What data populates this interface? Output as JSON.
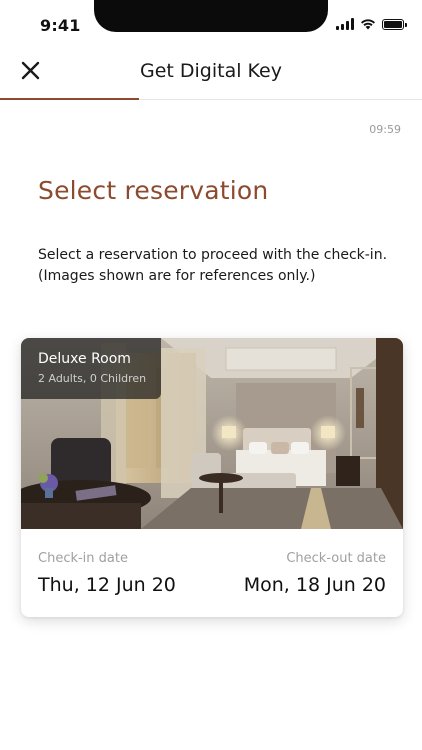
{
  "status_bar": {
    "time": "9:41",
    "icons": [
      "signal-icon",
      "wifi-icon",
      "battery-icon"
    ]
  },
  "header": {
    "title": "Get Digital Key",
    "close_icon": "close-icon",
    "progress_fraction": 0.33
  },
  "timer": "09:59",
  "page": {
    "title": "Select reservation",
    "description": "Select a reservation to proceed with the check-in. (Images shown are for references only.)"
  },
  "reservation": {
    "room_name": "Deluxe Room",
    "guests": "2 Adults, 0 Children",
    "checkin_label": "Check-in date",
    "checkin_date": "Thu, 12 Jun 20",
    "checkout_label": "Check-out date",
    "checkout_date": "Mon, 18 Jun 20"
  },
  "colors": {
    "accent": "#8c4a2f",
    "muted_text": "#a0a0a0",
    "text": "#1a1a1a"
  }
}
